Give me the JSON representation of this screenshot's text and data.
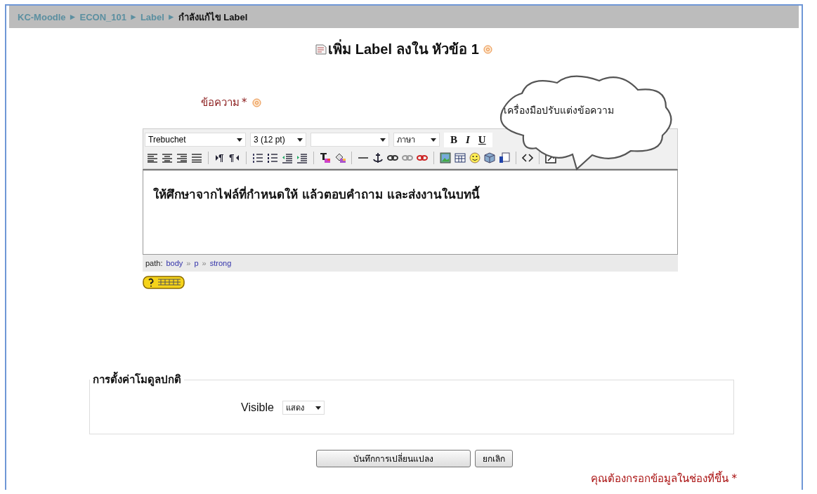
{
  "breadcrumb": {
    "separator": "►",
    "items": [
      {
        "text": "KC-Moodle",
        "link": true
      },
      {
        "text": "ECON_101",
        "link": true
      },
      {
        "text": "Label",
        "link": true
      },
      {
        "text": "กำลังแก้ไข Label",
        "link": false
      }
    ]
  },
  "heading": "เพิ่ม Label ลงใน หัวข้อ 1",
  "field_label": {
    "text": "ข้อความ",
    "required": "*"
  },
  "callout": "เครื่องมือปรับแต่งข้อความ",
  "editor": {
    "font": "Trebuchet",
    "size": "3 (12 pt)",
    "language": "ภาษา",
    "format_buttons": [
      "B",
      "I",
      "U"
    ],
    "content": "ให้ศึกษาจากไฟล์ที่กำหนดให้ แล้วตอบคำถาม และส่งงานในบทนี้",
    "path_label": "path:",
    "path_separator": "»",
    "path": [
      "body",
      "p",
      "strong"
    ]
  },
  "fieldset": {
    "legend": "การตั้งค่าโมดูลปกติ",
    "fields": [
      {
        "label": "Visible",
        "value": "แสดง"
      }
    ]
  },
  "buttons": [
    "บันทึกการเปลี่ยนแปลง",
    "ยกเลิก"
  ],
  "required_note": "คุณต้องกรอกข้อมูลในช่องที่ขึ้น *"
}
